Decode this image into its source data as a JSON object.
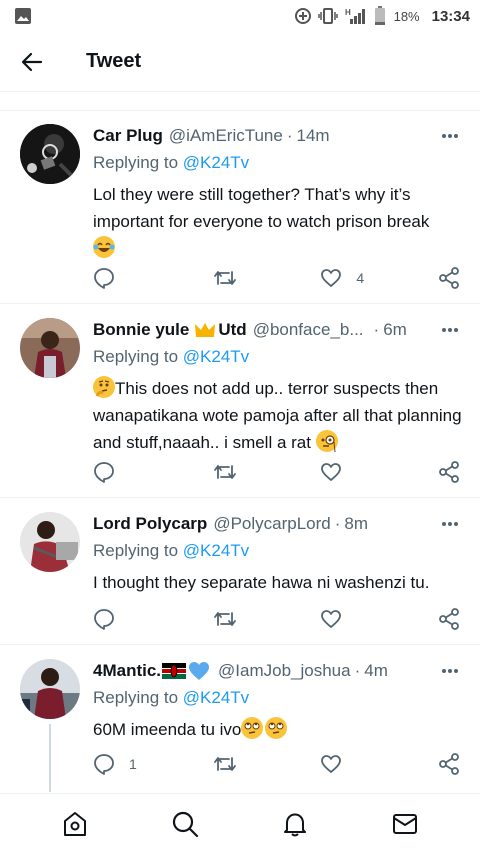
{
  "status_bar": {
    "battery": "18%",
    "time": "13:34",
    "network": "H",
    "icons": [
      "gallery-icon",
      "data-saver-icon",
      "vibrate-icon",
      "signal-icon",
      "battery-icon"
    ]
  },
  "header": {
    "title": "Tweet",
    "back_icon": "arrow-left-icon"
  },
  "tweets": [
    {
      "name": "Car Plug",
      "handle": "@iAmEricTune",
      "dot": "·",
      "time": "14m",
      "replying_prefix": "Replying to",
      "replying_to": "@K24Tv",
      "text": "Lol they were still together? That’s why it’s important for everyone to watch prison break",
      "reply_count": "",
      "retweet_count": "",
      "like_count": "4"
    },
    {
      "name": "Bonnie yule",
      "name_suffix": "Utd",
      "handle": "@bonface_b...",
      "dot": "·",
      "time": "6m",
      "replying_prefix": "Replying to",
      "replying_to": "@K24Tv",
      "text": "This does not add up.. terror suspects then wanapatikana wote pamoja after all that planning and stuff,naaah.. i smell a rat",
      "reply_count": "",
      "retweet_count": "",
      "like_count": ""
    },
    {
      "name": "Lord Polycarp",
      "handle": "@PolycarpLord",
      "dot": "·",
      "time": "8m",
      "replying_prefix": "Replying to",
      "replying_to": "@K24Tv",
      "text": "I thought they separate hawa ni washenzi tu.",
      "reply_count": "",
      "retweet_count": "",
      "like_count": ""
    },
    {
      "name": "4Mantic.",
      "handle": "@IamJob_joshua",
      "dot": "·",
      "time": "4m",
      "replying_prefix": "Replying to",
      "replying_to": "@K24Tv",
      "text": "60M imeenda tu ivo",
      "reply_count": "1",
      "retweet_count": "",
      "like_count": ""
    }
  ],
  "bottom_nav": [
    "home-icon",
    "search-icon",
    "notifications-icon",
    "messages-icon"
  ],
  "colors": {
    "accent": "#1d9bf0",
    "secondary_text": "#536471",
    "divider": "#eef0f2"
  }
}
